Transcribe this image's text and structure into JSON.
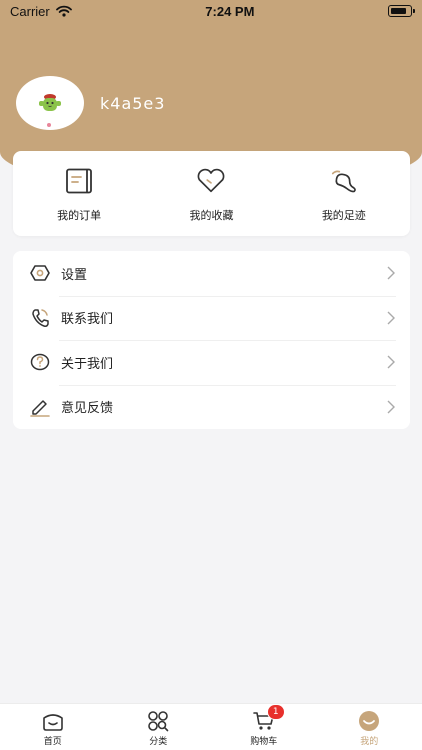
{
  "status_bar": {
    "carrier": "Carrier",
    "time": "7:24 PM"
  },
  "profile": {
    "username": "k4a5e3"
  },
  "quick_actions": [
    {
      "label": "我的订单",
      "icon": "order-icon"
    },
    {
      "label": "我的收藏",
      "icon": "heart-icon"
    },
    {
      "label": "我的足迹",
      "icon": "footprint-icon"
    }
  ],
  "menu": [
    {
      "label": "设置",
      "icon": "settings-icon"
    },
    {
      "label": "联系我们",
      "icon": "phone-icon"
    },
    {
      "label": "关于我们",
      "icon": "question-icon"
    },
    {
      "label": "意见反馈",
      "icon": "edit-icon"
    }
  ],
  "tabbar": {
    "tabs": [
      {
        "label": "首页",
        "icon": "home-icon"
      },
      {
        "label": "分类",
        "icon": "category-icon"
      },
      {
        "label": "购物车",
        "icon": "cart-icon",
        "badge": "1"
      },
      {
        "label": "我的",
        "icon": "profile-icon",
        "active": true
      }
    ]
  },
  "colors": {
    "accent": "#c6a57b",
    "badge": "#e8302c",
    "background": "#f4f4f6"
  }
}
